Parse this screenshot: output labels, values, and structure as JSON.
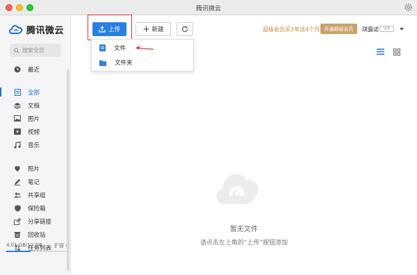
{
  "window": {
    "title": "腾讯微云"
  },
  "sidebar": {
    "logo_text": "腾讯微云",
    "search_placeholder": "搜索全部",
    "recent": "最近",
    "items_top": [
      "全部",
      "文档",
      "图片",
      "视频",
      "音乐"
    ],
    "items_bottom": [
      "照片",
      "笔记",
      "共享组",
      "保险箱",
      "分享链接",
      "回收站",
      "任务列表"
    ],
    "storage": {
      "used": "4.01 GB/10 GB",
      "expand": "扩容",
      "fill_fraction": 0.401
    }
  },
  "toolbar": {
    "upload_label": "上传",
    "new_label": "新建",
    "promo_text": "超级会员买2年送4个月",
    "promo_button": "开通超级会员",
    "username": "琪露诺",
    "vip_badge": "VIP"
  },
  "dropdown": {
    "items": [
      "文件",
      "文件夹"
    ]
  },
  "empty": {
    "title": "暂无文件",
    "hint": "请点击左上角的“上传”按钮添加"
  },
  "colors": {
    "accent": "#2a7fe5",
    "highlight": "#d9343a",
    "promo": "#c98a3a"
  }
}
